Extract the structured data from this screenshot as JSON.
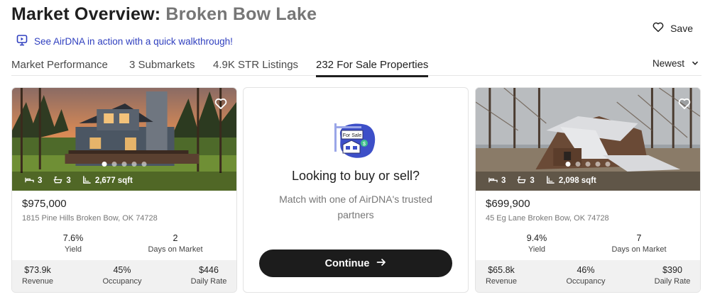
{
  "header": {
    "title_prefix": "Market Overview: ",
    "title_location": "Broken Bow Lake",
    "walkthrough_link": "See AirDNA in action with a quick walkthrough!",
    "save_label": "Save"
  },
  "tabs": [
    {
      "label": "Market Performance",
      "active": false
    },
    {
      "label": "3 Submarkets",
      "active": false
    },
    {
      "label": "4.9K STR Listings",
      "active": false
    },
    {
      "label": "232 For Sale Properties",
      "active": true
    }
  ],
  "sort": {
    "label": "Newest"
  },
  "listings": [
    {
      "beds": "3",
      "baths": "3",
      "sqft": "2,677 sqft",
      "price": "$975,000",
      "address": "1815 Pine Hills Broken Bow, OK 74728",
      "yield": "7.6%",
      "yield_label": "Yield",
      "days": "2",
      "days_label": "Days on Market",
      "revenue": "$73.9k",
      "revenue_label": "Revenue",
      "occupancy": "45%",
      "occupancy_label": "Occupancy",
      "daily_rate": "$446",
      "daily_rate_label": "Daily Rate",
      "photo_index": 1,
      "photo_count": 5
    },
    {
      "beds": "3",
      "baths": "3",
      "sqft": "2,098 sqft",
      "price": "$699,900",
      "address": "45 Eg Lane Broken Bow, OK 74728",
      "yield": "9.4%",
      "yield_label": "Yield",
      "days": "7",
      "days_label": "Days on Market",
      "revenue": "$65.8k",
      "revenue_label": "Revenue",
      "occupancy": "46%",
      "occupancy_label": "Occupancy",
      "daily_rate": "$390",
      "daily_rate_label": "Daily Rate",
      "photo_index": 1,
      "photo_count": 5
    }
  ],
  "promo": {
    "sign_text": "For Sale",
    "title": "Looking to buy or sell?",
    "subtitle": "Match with one of AirDNA's trusted partners",
    "button_label": "Continue"
  },
  "colors": {
    "link": "#2f3fbf",
    "button": "#1c1c1c",
    "stats_bg": "#f1f1f1"
  },
  "icons": [
    "monitor-play-icon",
    "heart-icon",
    "chevron-down-icon",
    "bed-icon",
    "bath-icon",
    "area-icon",
    "arrow-right-icon"
  ]
}
